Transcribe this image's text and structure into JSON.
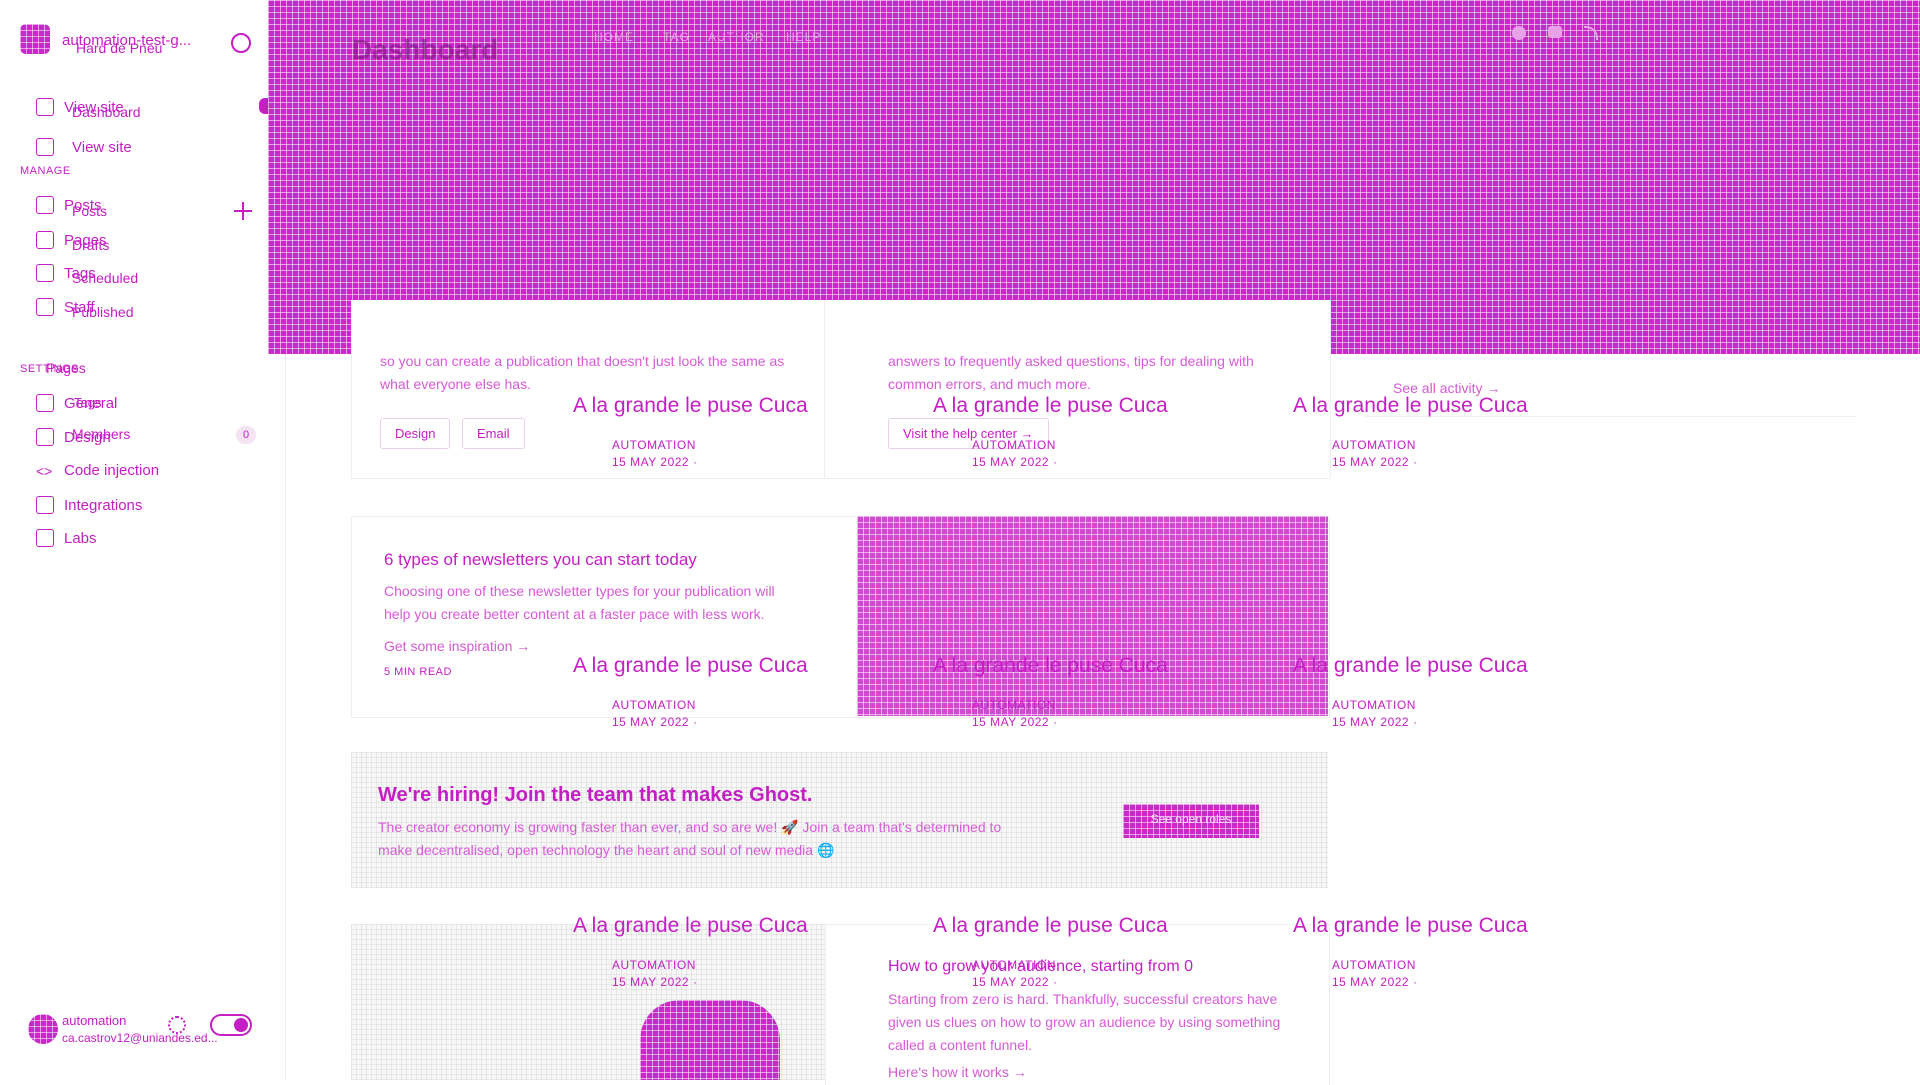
{
  "sidebar": {
    "site_title": "automation-test-g...",
    "site_title_overlay": "Hard de Pneu",
    "view_site_overlay": "View site",
    "nav_dashboard": "Dashboard",
    "nav_view_site": "View site",
    "manage_label": "MANAGE",
    "nav_posts_a": "Posts",
    "nav_posts_b": "Posts",
    "nav_pages_a": "Pages",
    "nav_drafts": "Drafts",
    "nav_tags": "Tags",
    "nav_scheduled": "Scheduled",
    "nav_staff": "Staff",
    "nav_published": "Published",
    "settings_label": "SETTINGS",
    "nav_pages_b": "Pages",
    "nav_general": "General",
    "nav_tags_b": "Tags",
    "nav_design": "Design",
    "nav_members": "Members",
    "members_count": "0",
    "nav_code_injection": "Code injection",
    "nav_integrations": "Integrations",
    "nav_labs": "Labs",
    "user_name": "automation",
    "user_email": "ca.castrov12@uniandes.ed..."
  },
  "header": {
    "title": "Dashboard",
    "nav": [
      "HOME",
      "TAG",
      "AUTHOR",
      "HELP"
    ]
  },
  "cards_top": {
    "left_text": "so you can create a publication that doesn't just look the same as what everyone else has.",
    "btn_design": "Design",
    "btn_email": "Email",
    "middle_text": "answers to frequently asked questions, tips for dealing with common errors, and much more.",
    "help_link": "Visit the help center →",
    "activity_link": "See all activity →"
  },
  "overlay_posts": {
    "title": "A la grande le puse Cuca",
    "author": "AUTOMATION",
    "date": "15 MAY 2022 ·"
  },
  "newsletter": {
    "title": "6 types of newsletters you can start today",
    "text": "Choosing one of these newsletter types for your publication will help you create better content at a faster pace with less work.",
    "link": "Get some inspiration →",
    "meta": "5 MIN READ"
  },
  "hiring": {
    "title": "We're hiring! Join the team that makes Ghost.",
    "text": "The creator economy is growing faster than ever, and so are we! 🚀 Join a team that's determined to make decentralised, open technology the heart and soul of new media 🌐",
    "button": "See open roles"
  },
  "grow": {
    "title": "How to grow your audience, starting from 0",
    "text": "Starting from zero is hard. Thankfully, successful creators have given us clues on how to grow an audience by using something called a content funnel.",
    "link": "Here's how it works →"
  }
}
